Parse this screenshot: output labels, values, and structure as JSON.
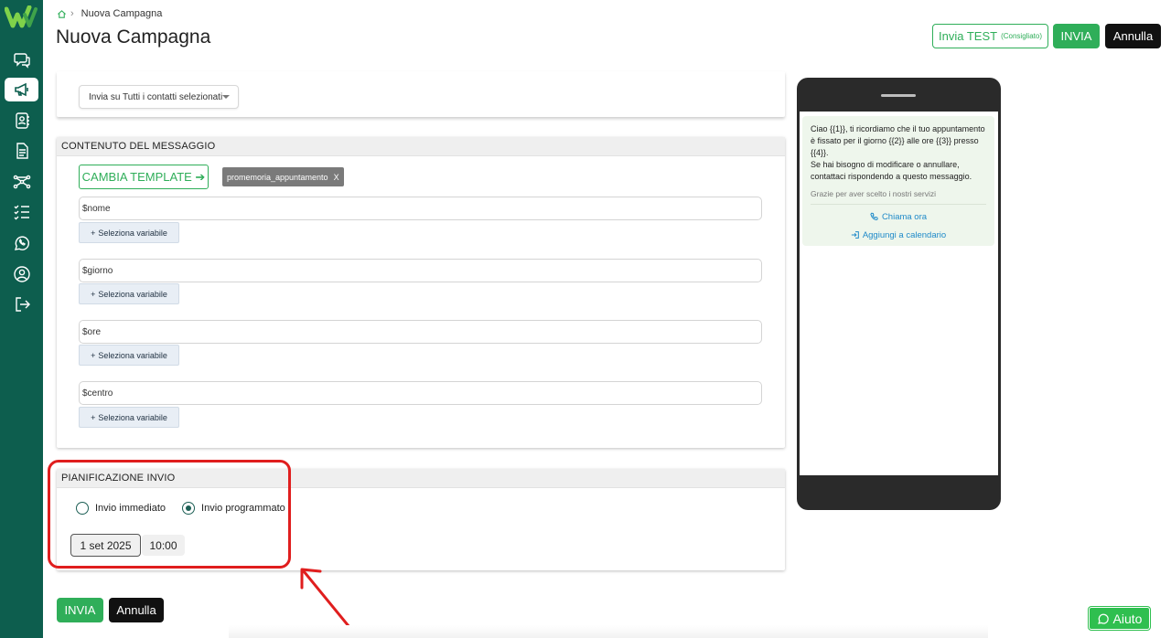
{
  "breadcrumb": {
    "current": "Nuova Campagna"
  },
  "page_title": "Nuova Campagna",
  "header_buttons": {
    "test_label": "Invia TEST",
    "test_hint": "(Consigliato)",
    "send_label": "INVIA",
    "cancel_label": "Annulla"
  },
  "recipients": {
    "selected": "Invia su Tutti i contatti selezionati"
  },
  "message_section": {
    "title": "CONTENUTO DEL MESSAGGIO",
    "change_template_label": "CAMBIA TEMPLATE ➔",
    "template_tag": "promemoria_appuntamento",
    "template_tag_remove": "X",
    "variables": [
      {
        "value": "$nome",
        "select_label": "Seleziona variabile"
      },
      {
        "value": "$giorno",
        "select_label": "Seleziona variabile"
      },
      {
        "value": "$ore",
        "select_label": "Seleziona variabile"
      },
      {
        "value": "$centro",
        "select_label": "Seleziona variabile"
      }
    ]
  },
  "schedule_section": {
    "title": "PIANIFICAZIONE INVIO",
    "option_immediate": "Invio immediato",
    "option_scheduled": "Invio programmato",
    "selected_option": "Invio programmato",
    "date": "1 set 2025",
    "time": "10:00"
  },
  "bottom_buttons": {
    "send_label": "INVIA",
    "cancel_label": "Annulla"
  },
  "preview": {
    "line1": "Ciao {{1}}, ti ricordiamo che il tuo appuntamento è fissato per il giorno {{2}} alle ore {{3}} presso {{4}}.",
    "line2": "Se hai bisogno di modificare o annullare, contattaci rispondendo a questo messaggio.",
    "footer": "Grazie per aver scelto i nostri servizi",
    "action_call": "Chiama ora",
    "action_calendar": "Aggiungi a calendario"
  },
  "help_button": {
    "label": "Aiuto"
  },
  "colors": {
    "sidebar": "#0d5e4e",
    "accent_green": "#2fae59",
    "highlight_red": "#e01e1e"
  },
  "sidebar_icons": [
    "chat-icon",
    "megaphone-icon",
    "contacts-icon",
    "document-icon",
    "flow-icon",
    "checklist-icon",
    "whatsapp-icon",
    "user-icon",
    "logout-icon"
  ]
}
